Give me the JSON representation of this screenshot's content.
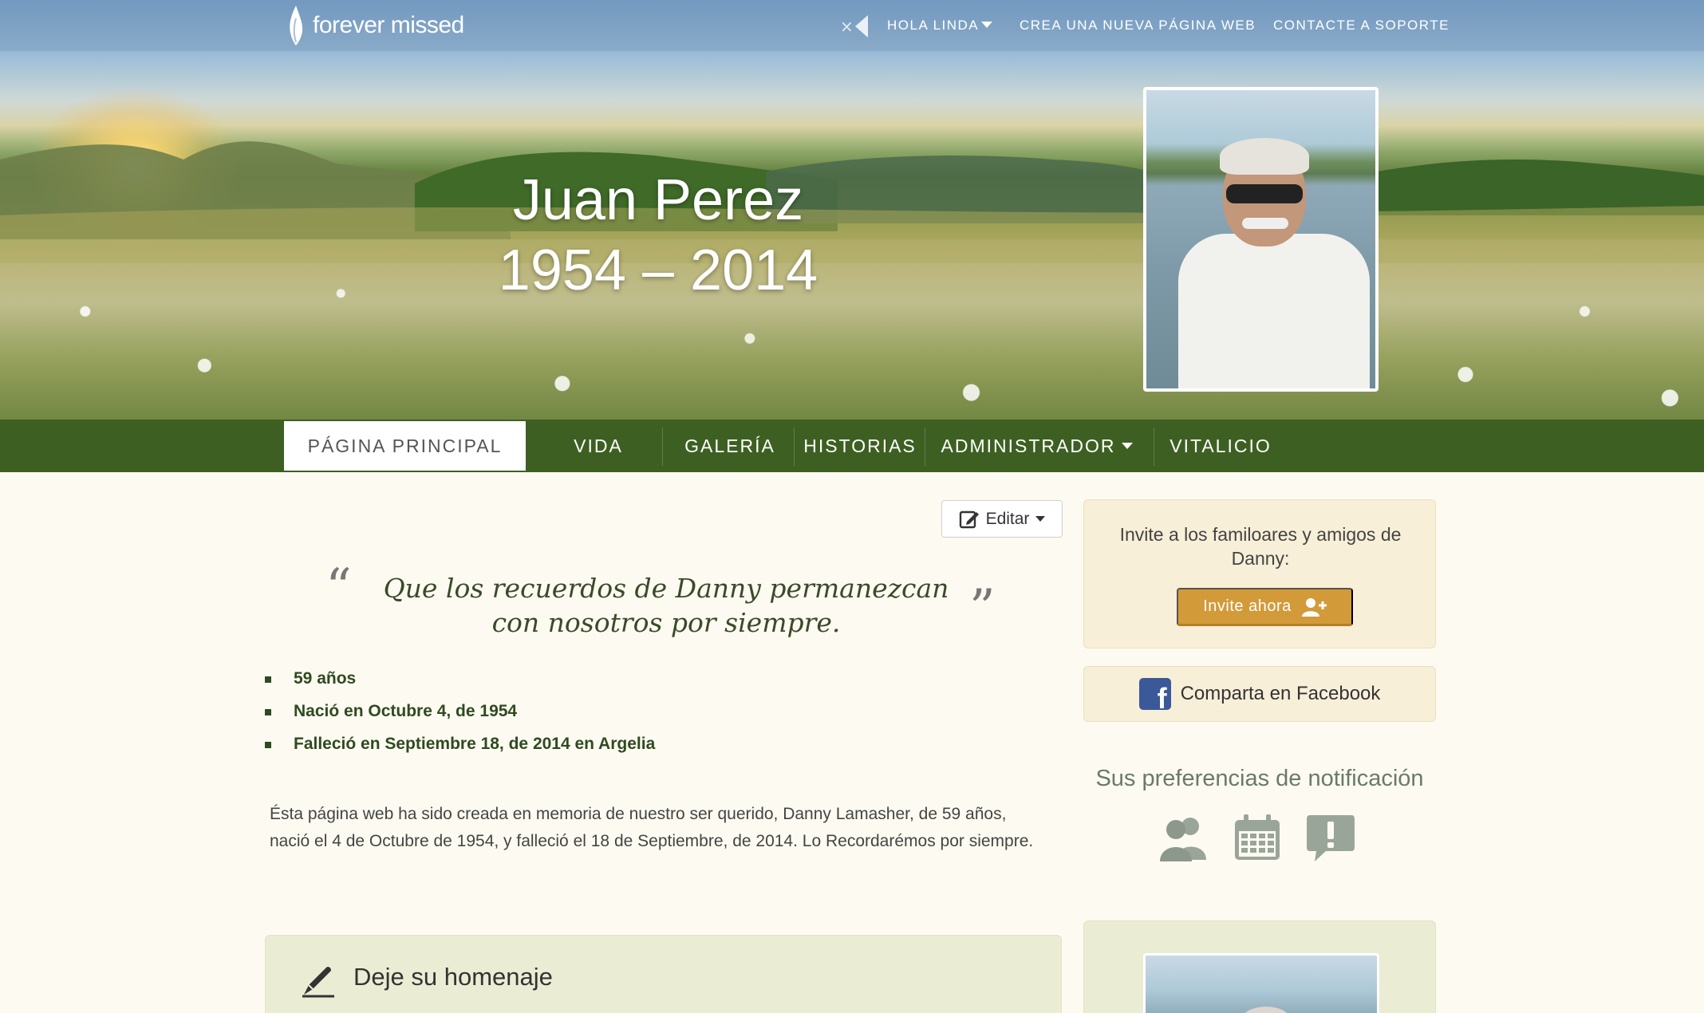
{
  "brand": {
    "logo_text": "forever missed"
  },
  "top_nav": {
    "user_menu": "HOLA LINDA",
    "create_site": "CREA UNA NUEVA PÁGINA WEB",
    "support": "CONTACTE A SOPORTE",
    "mute_icon": "speaker-mute-icon"
  },
  "hero": {
    "name": "Juan Perez",
    "dates": "1954 – 2014"
  },
  "main_nav": {
    "items": [
      {
        "label": "PÁGINA PRINCIPAL",
        "active": true
      },
      {
        "label": "VIDA",
        "active": false
      },
      {
        "label": "GALERÍA",
        "active": false
      },
      {
        "label": "HISTORIAS",
        "active": false
      },
      {
        "label": "ADMINISTRADOR",
        "active": false,
        "has_dropdown": true
      },
      {
        "label": "VITALICIO",
        "active": false
      }
    ],
    "bg_color": "#3d6022"
  },
  "content": {
    "edit_label": "Editar",
    "quote": "Que los recuerdos de Danny permanezcan con nosotros por siempre.",
    "quote_open": "“",
    "quote_close": "”",
    "facts": [
      "59 años",
      "Nació en Octubre 4, de 1954",
      "Falleció en Septiembre 18, de 2014 en Argelia"
    ],
    "bio": "Ésta página web ha sido creada en memoria de nuestro ser querido, Danny Lamasher, de 59 años, nació el 4 de Octubre de 1954, y falleció el 18 de Septiembre, de 2014. Lo Recordarémos por siempre.",
    "tribute_title": "Deje su homenaje"
  },
  "sidebar": {
    "invite_text": "Invite a los familoares y amigos de Danny:",
    "invite_button": "Invite ahora",
    "facebook_share": "Comparta en Facebook",
    "notif_title": "Sus preferencias de notificación",
    "notif_icons": [
      "users-icon",
      "calendar-icon",
      "alert-bubble-icon"
    ]
  },
  "colors": {
    "accent_green": "#3d6022",
    "invite_button": "#d39a3a",
    "facebook_blue": "#3b5998",
    "panel_beige": "#f8efd8",
    "panel_green": "#eaedd4"
  }
}
